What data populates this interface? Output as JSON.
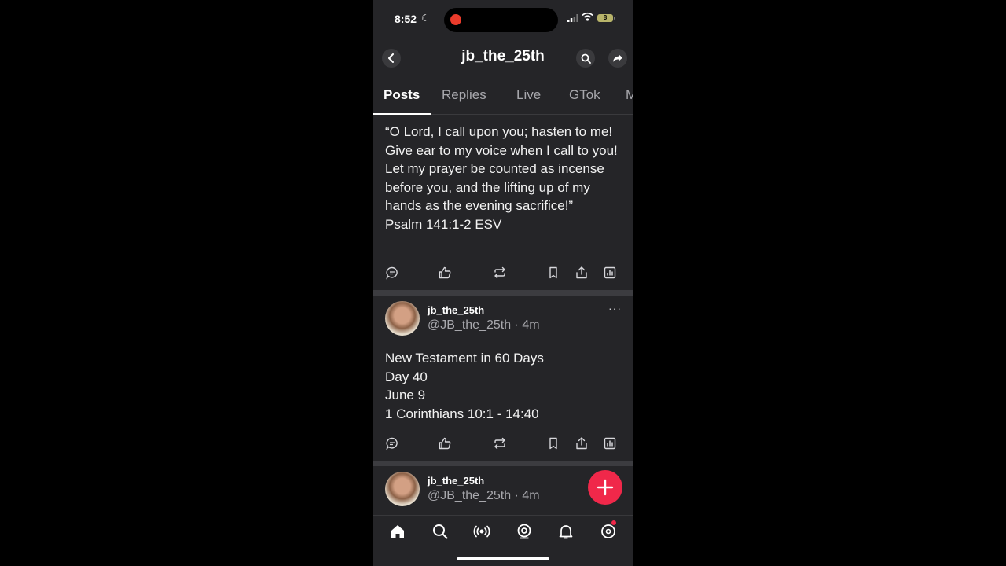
{
  "status": {
    "time": "8:52",
    "battery": "8"
  },
  "header": {
    "title": "jb_the_25th"
  },
  "tabs": [
    {
      "label": "Posts",
      "active": true
    },
    {
      "label": "Replies"
    },
    {
      "label": "Live"
    },
    {
      "label": "GTok"
    },
    {
      "label": "M"
    }
  ],
  "posts": [
    {
      "text": "“O Lord, I call upon you; hasten to me! Give ear to my voice when I call to you! Let my prayer be counted as incense before you, and the lifting up of my hands as the evening sacrifice!”",
      "citation": "Psalm 141:1-2 ESV"
    },
    {
      "username": "jb_the_25th",
      "handle": "@JB_the_25th · 4m",
      "lines": [
        "New Testament in 60 Days",
        "Day 40",
        "June 9",
        "1 Corinthians 10:1 - 14:40"
      ]
    },
    {
      "username": "jb_the_25th",
      "handle": "@JB_the_25th · 4m"
    }
  ],
  "more_label": "···",
  "colors": {
    "accent": "#f0284a",
    "background": "#252528",
    "divider": "#3c3c40"
  }
}
